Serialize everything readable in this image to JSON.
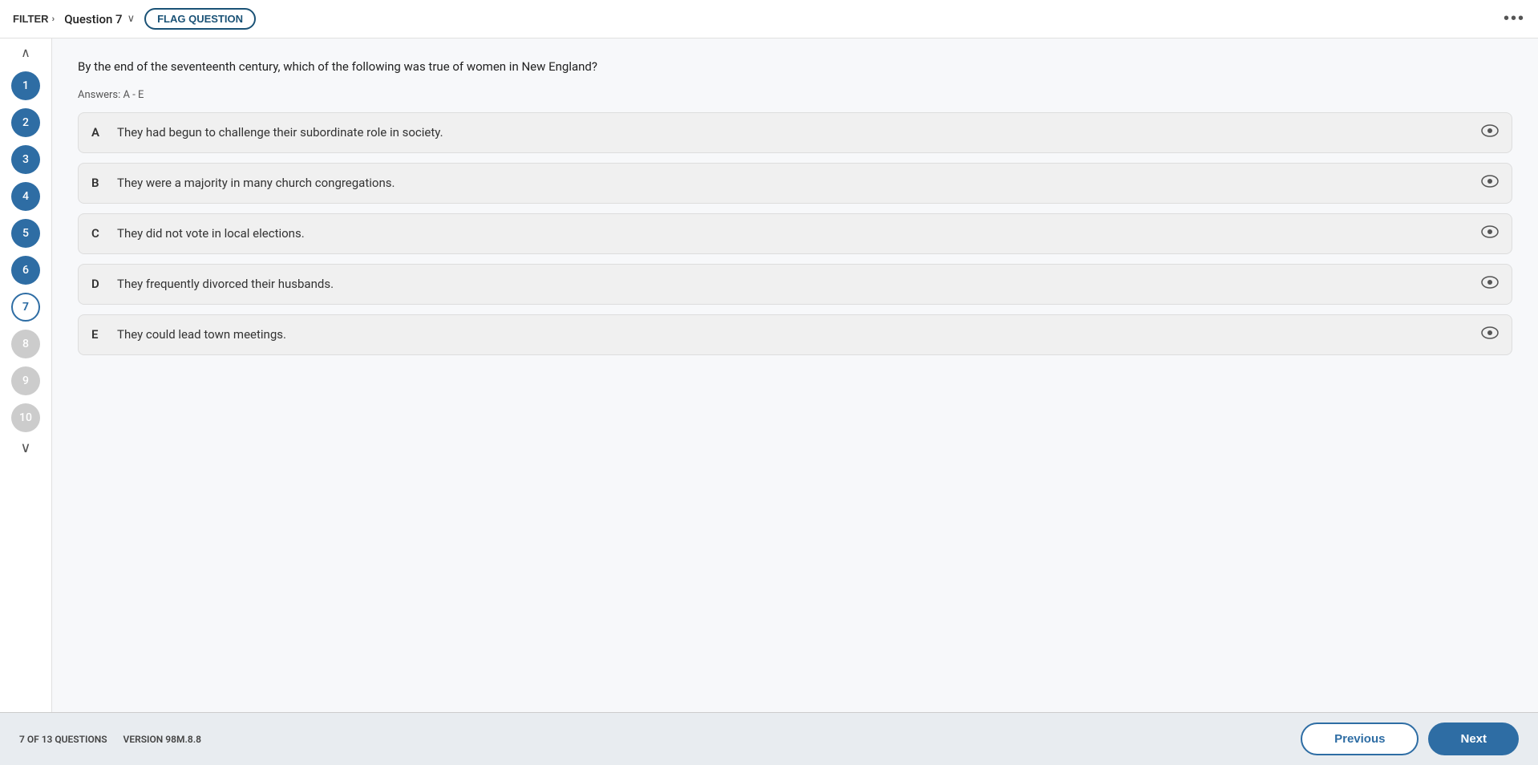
{
  "header": {
    "filter_label": "FILTER",
    "filter_chevron": "›",
    "question_label": "Question 7",
    "question_chevron": "∨",
    "flag_button": "FLAG QUESTION",
    "more_icon": "•••"
  },
  "sidebar": {
    "collapse_icon": "∧",
    "more_icon": "∨",
    "items": [
      {
        "num": "1",
        "state": "visited"
      },
      {
        "num": "2",
        "state": "visited"
      },
      {
        "num": "3",
        "state": "visited"
      },
      {
        "num": "4",
        "state": "visited"
      },
      {
        "num": "5",
        "state": "visited"
      },
      {
        "num": "6",
        "state": "visited"
      },
      {
        "num": "7",
        "state": "current"
      },
      {
        "num": "8",
        "state": "unvisited"
      },
      {
        "num": "9",
        "state": "unvisited"
      },
      {
        "num": "10",
        "state": "unvisited"
      }
    ]
  },
  "question": {
    "text": "By the end of the seventeenth century, which of the following was true of women in New England?",
    "answers_label": "Answers: A - E",
    "options": [
      {
        "letter": "A",
        "text": "They had begun to challenge their subordinate role in society."
      },
      {
        "letter": "B",
        "text": "They were a majority in many church congregations."
      },
      {
        "letter": "C",
        "text": "They did not vote in local elections."
      },
      {
        "letter": "D",
        "text": "They frequently divorced their husbands."
      },
      {
        "letter": "E",
        "text": "They could lead town meetings."
      }
    ]
  },
  "footer": {
    "progress": "7 OF 13 QUESTIONS",
    "version": "VERSION 98M.8.8",
    "prev_label": "Previous",
    "next_label": "Next"
  }
}
